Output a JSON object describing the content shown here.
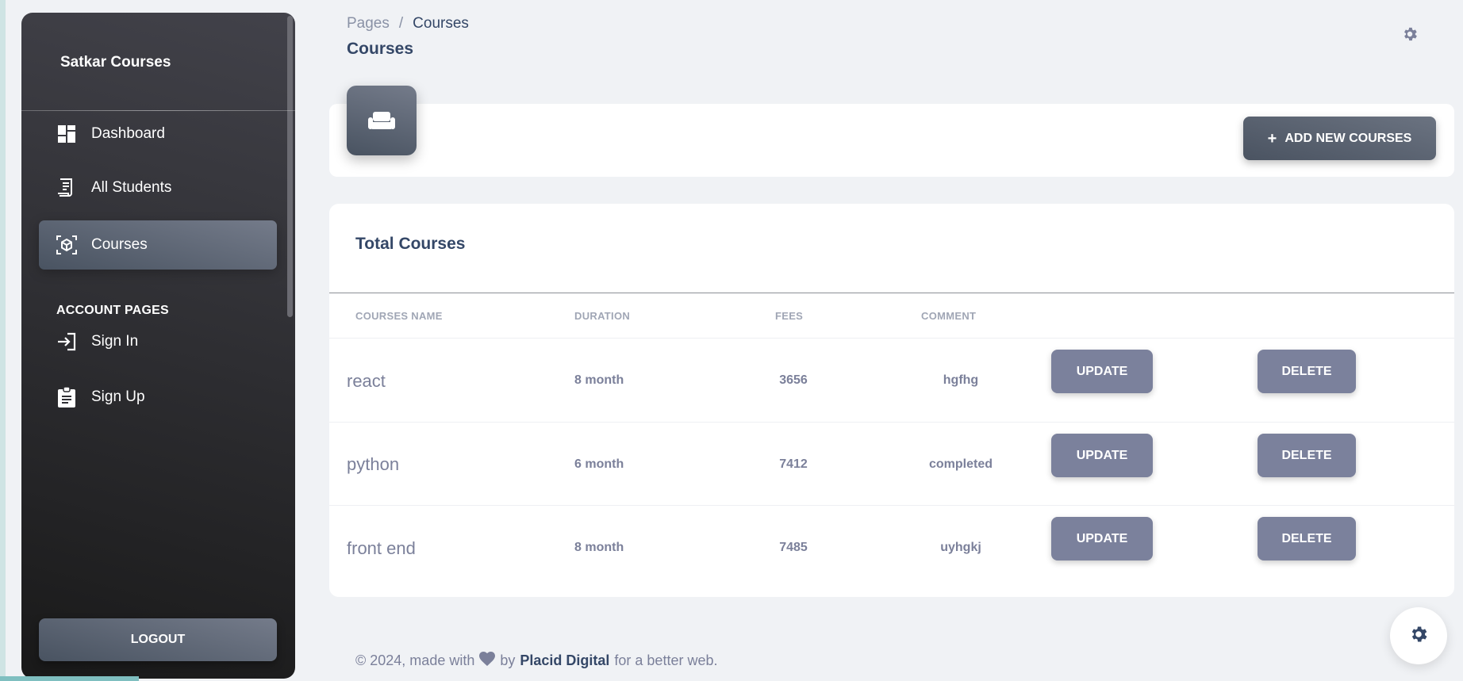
{
  "sidebar": {
    "brand": "Satkar Courses",
    "items": [
      {
        "label": "Dashboard",
        "icon": "dashboard-icon"
      },
      {
        "label": "All Students",
        "icon": "receipt-icon"
      },
      {
        "label": "Courses",
        "icon": "view-in-ar-icon",
        "active": true
      }
    ],
    "section_title": "ACCOUNT PAGES",
    "account_items": [
      {
        "label": "Sign In",
        "icon": "login-icon"
      },
      {
        "label": "Sign Up",
        "icon": "assignment-icon"
      }
    ],
    "logout_label": "LOGOUT"
  },
  "topbar": {
    "breadcrumb": {
      "root": "Pages",
      "separator": "/",
      "current": "Courses"
    },
    "title": "Courses",
    "settings_icon": "gear-icon"
  },
  "header": {
    "icon": "weekend-icon",
    "add_button": {
      "icon": "+",
      "label": "ADD NEW COURSES"
    }
  },
  "table": {
    "title": "Total Courses",
    "columns": [
      "COURSES NAME",
      "DURATION",
      "FEES",
      "COMMENT"
    ],
    "rows": [
      {
        "name": "react",
        "duration": "8 month",
        "fees": "3656",
        "comment": "hgfhg"
      },
      {
        "name": "python",
        "duration": "6 month",
        "fees": "7412",
        "comment": "completed"
      },
      {
        "name": "front end",
        "duration": "8 month",
        "fees": "7485",
        "comment": "uyhgkj"
      }
    ],
    "update_label": "UPDATE",
    "delete_label": "DELETE"
  },
  "footer": {
    "prefix": "© 2024, made with",
    "by": "by",
    "company": "Placid Digital",
    "suffix": "for a better web."
  },
  "colors": {
    "sidebar_gradient_start": "#42424a",
    "sidebar_gradient_end": "#191919",
    "accent": "#495361",
    "row_button": "#7b819c",
    "background": "#f0f2f5"
  }
}
